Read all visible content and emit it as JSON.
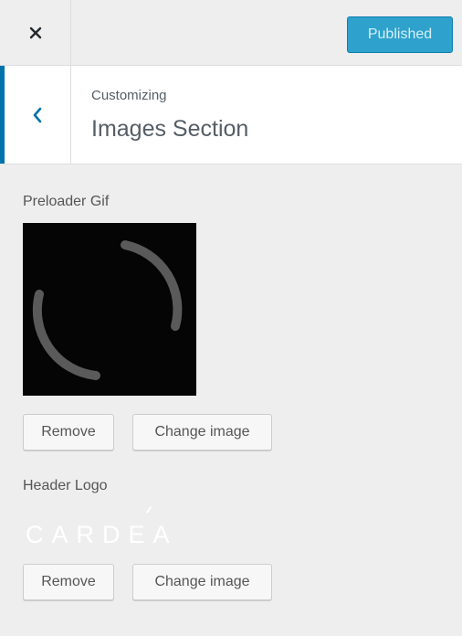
{
  "topbar": {
    "close_icon": "close-icon",
    "publish_label": "Published",
    "accent_color": "#2ea2cc"
  },
  "section": {
    "back_icon": "chevron-left-icon",
    "subtitle": "Customizing",
    "title": "Images Section"
  },
  "controls": {
    "preloader": {
      "label": "Preloader Gif",
      "remove_label": "Remove",
      "change_label": "Change image"
    },
    "header_logo": {
      "label": "Header Logo",
      "logo_text": "CARDEA",
      "remove_label": "Remove",
      "change_label": "Change image"
    }
  }
}
